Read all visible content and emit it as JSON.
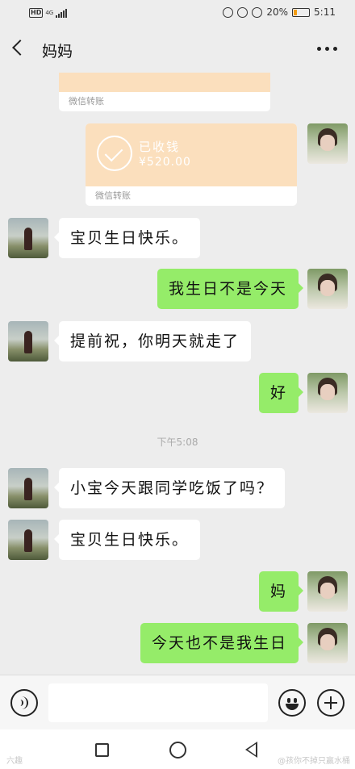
{
  "status_bar": {
    "hd": "HD",
    "network": "4G",
    "battery_percent": "20%",
    "time": "5:11"
  },
  "header": {
    "title": "妈妈"
  },
  "messages": [
    {
      "type": "transfer-partial",
      "from": "me",
      "footer": "微信转账"
    },
    {
      "type": "transfer",
      "from": "me",
      "status": "已收钱",
      "amount": "¥520.00",
      "footer": "微信转账"
    },
    {
      "type": "text",
      "from": "mom",
      "text": "宝贝生日快乐。"
    },
    {
      "type": "text",
      "from": "me",
      "text": "我生日不是今天"
    },
    {
      "type": "text",
      "from": "mom",
      "text": "提前祝，你明天就走了"
    },
    {
      "type": "text",
      "from": "me",
      "text": "好"
    },
    {
      "type": "time",
      "text": "下午5:08"
    },
    {
      "type": "text",
      "from": "mom",
      "text": "小宝今天跟同学吃饭了吗？"
    },
    {
      "type": "text",
      "from": "mom",
      "text": "宝贝生日快乐。"
    },
    {
      "type": "text",
      "from": "me",
      "text": "妈"
    },
    {
      "type": "text",
      "from": "me",
      "text": "今天也不是我生日"
    }
  ],
  "input_bar": {
    "voice_icon": "voice-icon",
    "emoji_icon": "emoji-icon",
    "plus_icon": "plus-icon"
  },
  "watermarks": {
    "left": "六趣",
    "right": "@孩你不掉只赢水桶"
  },
  "colors": {
    "background": "#ededed",
    "outgoing_bubble": "#95ec69",
    "incoming_bubble": "#ffffff",
    "transfer": "#fbdfbd"
  }
}
